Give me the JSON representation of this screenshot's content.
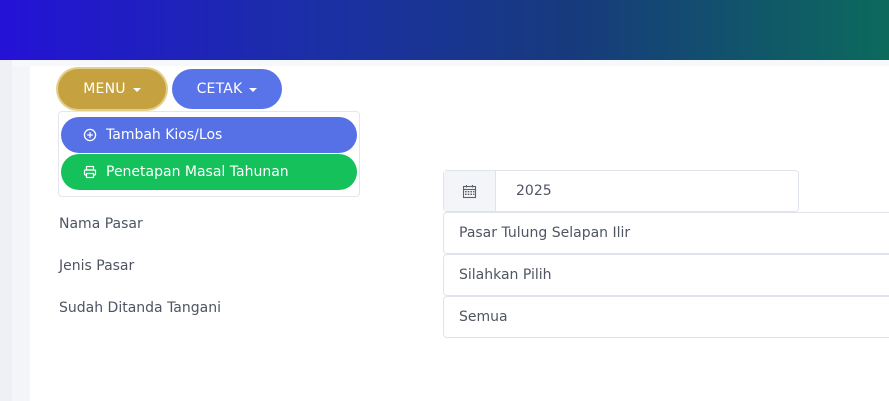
{
  "toolbar": {
    "menu_label": "MENU",
    "cetak_label": "CETAK"
  },
  "dropdown": {
    "items": [
      {
        "label": "Tambah Kios/Los",
        "icon": "plus-circle-icon",
        "color": "#5670e6"
      },
      {
        "label": "Penetapan Masal Tahunan",
        "icon": "printer-icon",
        "color": "#14c15a"
      }
    ]
  },
  "form": {
    "year": {
      "icon": "calendar-icon",
      "value": "2025"
    },
    "nama_pasar": {
      "label": "Nama Pasar",
      "value": "Pasar Tulung Selapan Ilir"
    },
    "jenis_pasar": {
      "label": "Jenis Pasar",
      "value": "Silahkan Pilih"
    },
    "sudah_ditanda_tangani": {
      "label": "Sudah Ditanda Tangani",
      "value": "Semua"
    }
  },
  "colors": {
    "menu_button": "#c5a23f",
    "cetak_button": "#5973e9",
    "topbar_start": "#2412d6",
    "topbar_end": "#0c6a5c"
  }
}
